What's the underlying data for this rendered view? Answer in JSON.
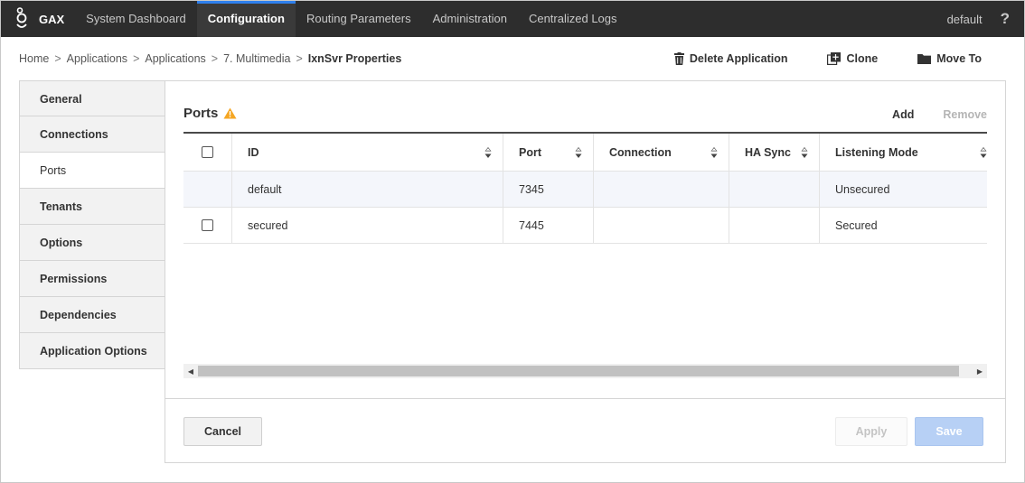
{
  "topnav": {
    "brand": "GAX",
    "items": [
      {
        "label": "System Dashboard"
      },
      {
        "label": "Configuration"
      },
      {
        "label": "Routing Parameters"
      },
      {
        "label": "Administration"
      },
      {
        "label": "Centralized Logs"
      }
    ],
    "active_index": 1,
    "user": "default",
    "help": "?"
  },
  "breadcrumb": {
    "items": [
      "Home",
      "Applications",
      "Applications",
      "7. Multimedia"
    ],
    "current": "IxnSvr Properties",
    "separator": ">"
  },
  "toolbar": {
    "delete_label": "Delete Application",
    "clone_label": "Clone",
    "move_label": "Move To"
  },
  "sidebar": {
    "items": [
      {
        "label": "General"
      },
      {
        "label": "Connections"
      },
      {
        "label": "Ports"
      },
      {
        "label": "Tenants"
      },
      {
        "label": "Options"
      },
      {
        "label": "Permissions"
      },
      {
        "label": "Dependencies"
      },
      {
        "label": "Application Options"
      }
    ],
    "active_index": 2
  },
  "panel": {
    "title": "Ports",
    "add_label": "Add",
    "remove_label": "Remove",
    "columns": [
      "ID",
      "Port",
      "Connection",
      "HA Sync",
      "Listening Mode"
    ],
    "rows": [
      {
        "id": "default",
        "port": "7345",
        "connection": "",
        "ha_sync": "",
        "listening_mode": "Unsecured",
        "selected": true
      },
      {
        "id": "secured",
        "port": "7445",
        "connection": "",
        "ha_sync": "",
        "listening_mode": "Secured",
        "selected": false
      }
    ]
  },
  "footer": {
    "cancel_label": "Cancel",
    "apply_label": "Apply",
    "save_label": "Save"
  },
  "colors": {
    "nav_bg": "#2d2d2d",
    "accent": "#2f80ed",
    "warning": "#f5a623",
    "save_disabled": "#b7d0f5"
  }
}
